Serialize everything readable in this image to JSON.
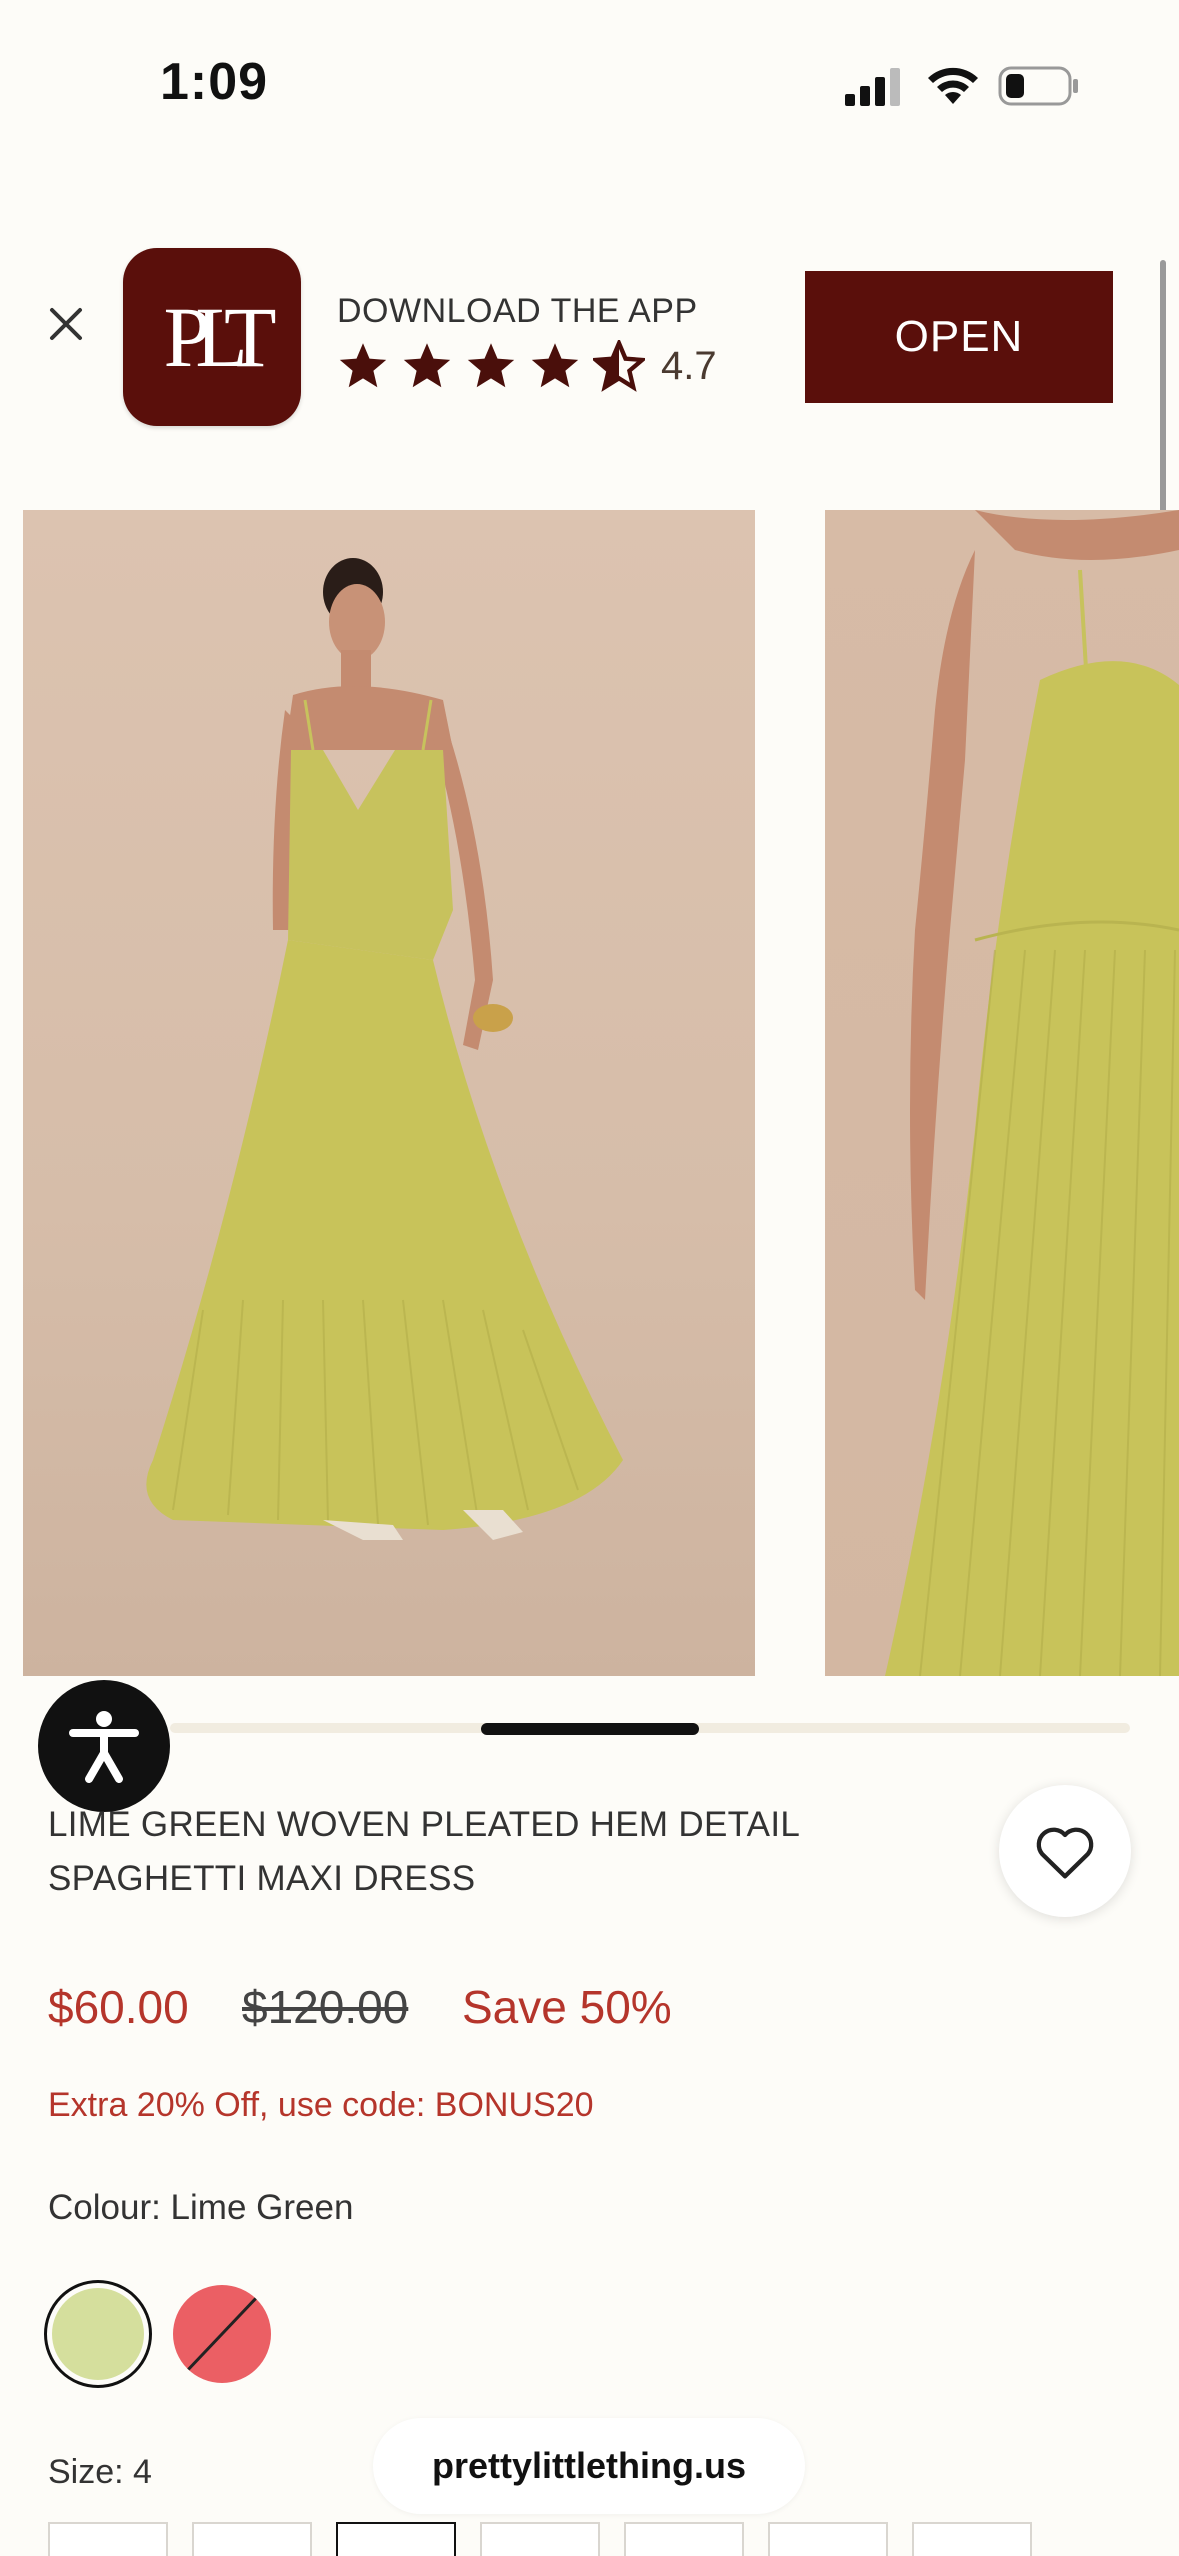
{
  "status_bar": {
    "time": "1:09"
  },
  "app_banner": {
    "title": "DOWNLOAD THE APP",
    "rating": "4.7",
    "stars": 4.5,
    "open_label": "OPEN",
    "logo_letters": "PLT",
    "brand_color": "#5a0f0b"
  },
  "gallery": {
    "images": [
      "model-front-view",
      "model-side-close-up"
    ],
    "progress_position": 0.35
  },
  "product": {
    "title": "LIME GREEN WOVEN PLEATED HEM DETAIL SPAGHETTI MAXI DRESS",
    "price": "$60.00",
    "original_price": "$120.00",
    "savings": "Save 50%",
    "promo": "Extra 20% Off, use code: BONUS20",
    "colour_label": "Colour: Lime Green",
    "colours": [
      {
        "name": "Lime Green",
        "hex": "#d5df9d",
        "selected": true
      },
      {
        "name": "Red",
        "hex": "#eb5f64",
        "selected": false,
        "unavailable": true
      }
    ],
    "size_label": "Size: 4"
  },
  "browser": {
    "url": "prettylittlething.us"
  },
  "icons": {
    "close": "close-icon",
    "heart": "heart-icon",
    "accessibility": "accessibility-icon"
  }
}
